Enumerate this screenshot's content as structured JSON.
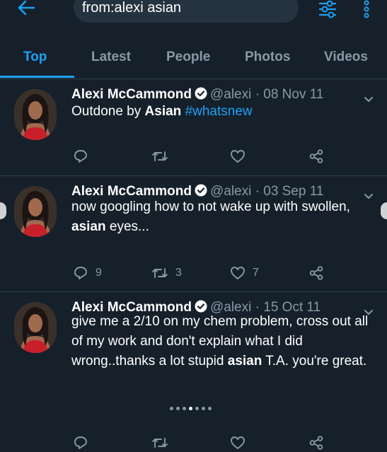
{
  "search": {
    "query": "from:alexi asian"
  },
  "tabs": [
    {
      "label": "Top",
      "active": true
    },
    {
      "label": "Latest",
      "active": false
    },
    {
      "label": "People",
      "active": false
    },
    {
      "label": "Photos",
      "active": false
    },
    {
      "label": "Videos",
      "active": false
    }
  ],
  "tweets": [
    {
      "name": "Alexi McCammond",
      "handle": "@alexi",
      "date": "08 Nov 11",
      "body": [
        {
          "t": "Outdone by "
        },
        {
          "t": "Asian",
          "bold": true
        },
        {
          "t": " "
        },
        {
          "t": "#whatsnew",
          "hashtag": true
        }
      ],
      "replies": "",
      "retweets": "",
      "likes": ""
    },
    {
      "name": "Alexi McCammond",
      "handle": "@alexi",
      "date": "03 Sep 11",
      "body": [
        {
          "t": "now googling how to not wake up with swollen, "
        },
        {
          "t": "asian",
          "bold": true
        },
        {
          "t": " eyes..."
        }
      ],
      "replies": "9",
      "retweets": "3",
      "likes": "7"
    },
    {
      "name": "Alexi McCammond",
      "handle": "@alexi",
      "date": "15 Oct 11",
      "body": [
        {
          "t": "give me a 2/10 on my chem problem, cross out all of my work and don't explain what I did wrong..thanks a lot stupid "
        },
        {
          "t": "asian",
          "bold": true
        },
        {
          "t": " T.A. you're great."
        }
      ],
      "replies": "",
      "retweets": "",
      "likes": ""
    }
  ],
  "colors": {
    "background": "#15202b",
    "accent": "#1da1f2",
    "muted": "#8899a6",
    "divider": "#2f3d4a"
  },
  "icons": [
    "back-arrow-icon",
    "filter-sliders-icon",
    "more-dots-icon",
    "verified-badge-icon",
    "chevron-down-icon",
    "reply-icon",
    "retweet-icon",
    "like-icon",
    "share-icon"
  ],
  "pager": {
    "count": 7,
    "active_index": 3
  }
}
